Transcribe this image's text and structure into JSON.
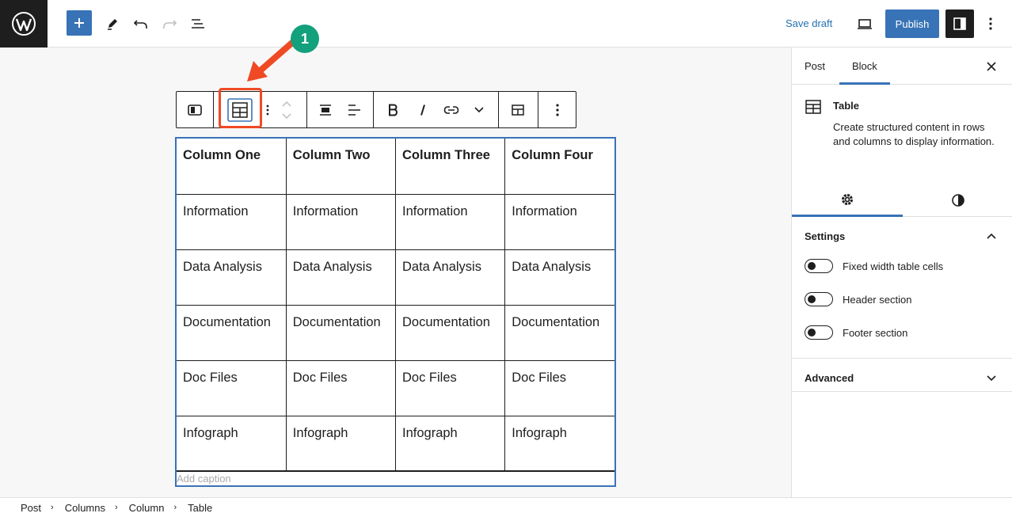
{
  "topbar": {
    "save_draft": "Save draft",
    "publish": "Publish"
  },
  "table": {
    "header": [
      "Column One",
      "Column Two",
      "Column Three",
      "Column Four"
    ],
    "rows": [
      [
        "Information",
        "Information",
        "Information",
        "Information"
      ],
      [
        "Data Analysis",
        "Data Analysis",
        "Data Analysis",
        "Data Analysis"
      ],
      [
        "Documentation",
        "Documentation",
        "Documentation",
        "Documentation"
      ],
      [
        "Doc Files",
        "Doc Files",
        "Doc Files",
        "Doc Files"
      ],
      [
        "Infograph",
        "Infograph",
        "Infograph",
        "Infograph"
      ]
    ],
    "caption_placeholder": "Add caption"
  },
  "annotation": {
    "badge": "1"
  },
  "sidebar": {
    "tabs": {
      "post": "Post",
      "block": "Block"
    },
    "block": {
      "title": "Table",
      "description": "Create structured content in rows and columns to display information."
    },
    "settings": {
      "heading": "Settings",
      "toggles": [
        "Fixed width table cells",
        "Header section",
        "Footer section"
      ]
    },
    "advanced": {
      "heading": "Advanced"
    }
  },
  "breadcrumb": [
    "Post",
    "Columns",
    "Column",
    "Table"
  ],
  "colors": {
    "accent": "#3873b7",
    "highlight": "#ef4a23",
    "badge": "#13a07c"
  }
}
